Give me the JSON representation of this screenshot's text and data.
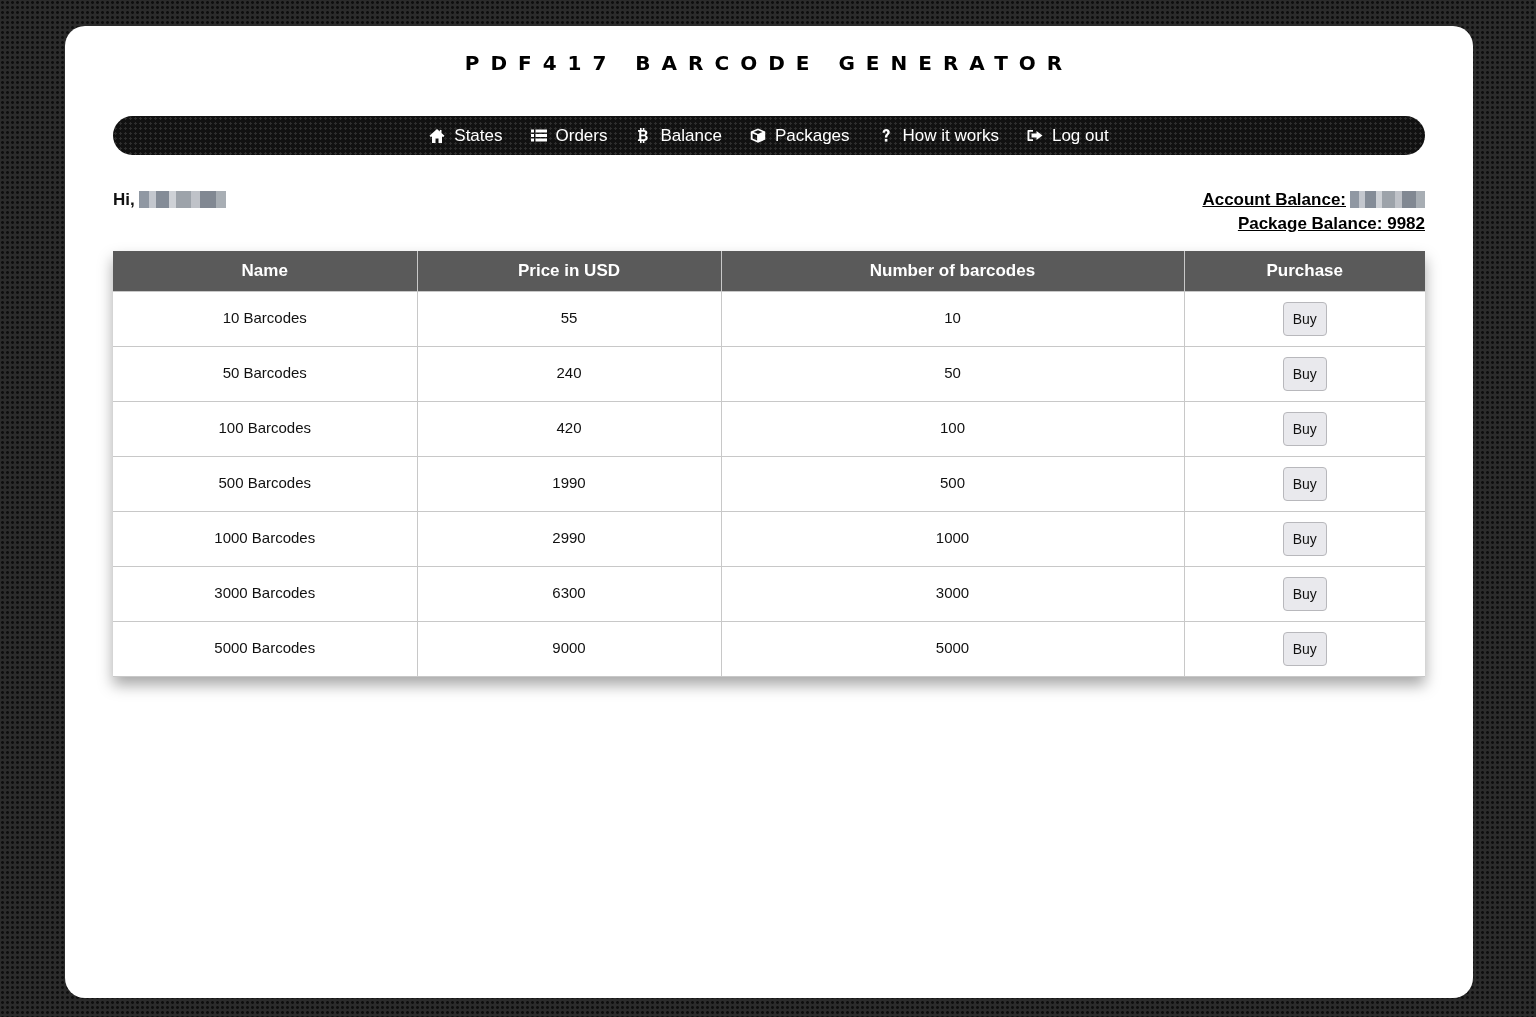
{
  "title": "PDF417 BARCODE GENERATOR",
  "nav": [
    {
      "kind": "home",
      "label": "States"
    },
    {
      "kind": "list",
      "label": "Orders"
    },
    {
      "kind": "bitcoin",
      "label": "Balance"
    },
    {
      "kind": "cube",
      "label": "Packages"
    },
    {
      "kind": "question",
      "label": "How it works"
    },
    {
      "kind": "logout",
      "label": "Log out"
    }
  ],
  "user": {
    "greeting": "Hi,",
    "name_blurred": true
  },
  "balances": [
    {
      "text": "Account Balance:",
      "blurred": true
    },
    {
      "text": "Package Balance: 9982",
      "blurred": false
    }
  ],
  "table": {
    "columns": [
      "Name",
      "Price in USD",
      "Number of barcodes",
      "Purchase"
    ],
    "rows": [
      {
        "name": "10 Barcodes",
        "price": "55",
        "count": "10",
        "action": "Buy"
      },
      {
        "name": "50 Barcodes",
        "price": "240",
        "count": "50",
        "action": "Buy"
      },
      {
        "name": "100 Barcodes",
        "price": "420",
        "count": "100",
        "action": "Buy"
      },
      {
        "name": "500 Barcodes",
        "price": "1990",
        "count": "500",
        "action": "Buy"
      },
      {
        "name": "1000 Barcodes",
        "price": "2990",
        "count": "1000",
        "action": "Buy"
      },
      {
        "name": "3000 Barcodes",
        "price": "6300",
        "count": "3000",
        "action": "Buy"
      },
      {
        "name": "5000 Barcodes",
        "price": "9000",
        "count": "5000",
        "action": "Buy"
      }
    ]
  }
}
